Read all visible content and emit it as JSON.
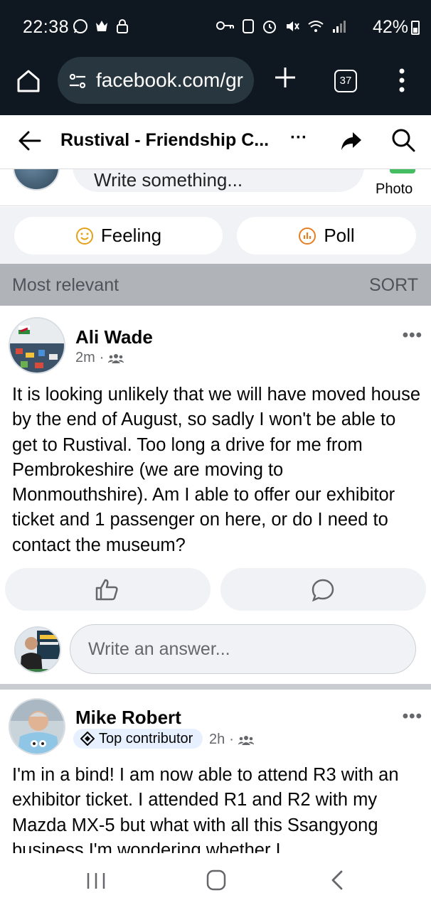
{
  "status_bar": {
    "time": "22:38",
    "battery": "42%"
  },
  "browser": {
    "url": "facebook.com/gr",
    "tab_count": "37"
  },
  "header": {
    "title": "Rustival - Friendship C...",
    "more": "···"
  },
  "composer": {
    "placeholder": "Write something...",
    "photo_label": "Photo"
  },
  "chips": {
    "feeling": "Feeling",
    "poll": "Poll"
  },
  "sort": {
    "label": "Most relevant",
    "button": "SORT"
  },
  "posts": [
    {
      "author": "Ali Wade",
      "time": "2m",
      "text": "It is looking unlikely that we will have moved house by the end of August, so sadly I won't be able to get to Rustival.  Too long a drive for me from Pembrokeshire (we are moving to Monmouthshire).  Am I able to offer our exhibitor ticket and 1 passenger on here, or do I need to contact the museum?",
      "reply_placeholder": "Write an answer..."
    },
    {
      "author": "Mike Robert",
      "badge": "Top contributor",
      "time": "2h",
      "text": "I'm in a bind! I am now able to attend R3 with an exhibitor ticket. I attended R1 and R2 with my Mazda MX-5 but what with all this Ssangyong business I'm wondering whether I"
    }
  ],
  "colors": {
    "status_bg": "#0f1720",
    "url_pill": "#27363f",
    "sort_bar": "#b0b3b8",
    "feeling_icon": "#e4a11b",
    "poll_icon": "#e67e22",
    "badge_bg": "#e7f0fe"
  }
}
